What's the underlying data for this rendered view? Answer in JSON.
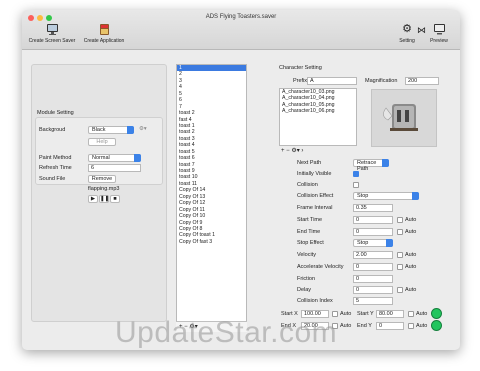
{
  "window": {
    "title": "ADS Flying Toasters.saver"
  },
  "toolbar": {
    "create_screen_saver": "Create Screen Saver",
    "create_application": "Create Application",
    "setting": "Setting",
    "preview": "Preview"
  },
  "module": {
    "heading": "Module Setting",
    "background_label": "Backgroud",
    "background_value": "Black",
    "help": "Help",
    "paint_method_label": "Paint Method",
    "paint_method_value": "Normal",
    "refresh_time_label": "Refresh Time",
    "refresh_time_value": "6",
    "sound_file_label": "Sound File",
    "remove": "Remove",
    "sound_file_name": "flapping.mp3",
    "controls": [
      "▶",
      "❚❚",
      "■"
    ]
  },
  "list": {
    "items": [
      "1",
      "2",
      "3",
      "4",
      "5",
      "6",
      "7",
      "toast 2",
      "fast 4",
      "toast 1",
      "toast 2",
      "toast 3",
      "toast 4",
      "toast 5",
      "toast 6",
      "toast 7",
      "toast 9",
      "toast 10",
      "toast 11",
      "Copy Of 14",
      "Copy Of 13",
      "Copy Of 12",
      "Copy Of 11",
      "Copy Of 10",
      "Copy Of 9",
      "Copy Of 8",
      "Copy Of toast 1",
      "Copy Of fast 3"
    ],
    "toolbar": "+ − ⚙▾"
  },
  "character": {
    "heading": "Character Setting",
    "prefix_label": "Prefix",
    "prefix_value": "A",
    "magnification_label": "Magnification",
    "magnification_value": "200",
    "files": [
      "A_character10_03.png",
      "A_character10_04.png",
      "A_character10_05.png",
      "A_character10_06.png"
    ],
    "file_toolbar": "+ − ⚙▾ ›"
  },
  "props": {
    "next_path_label": "Next Path",
    "next_path_value": "Retrace Path",
    "initially_visible_label": "Initially Visible",
    "collision_label": "Collision",
    "collision_effect_label": "Collision Effect",
    "collision_effect_value": "Stop",
    "frame_interval_label": "Frame Interval",
    "frame_interval_value": "0.35",
    "start_time_label": "Start Time",
    "start_time_value": "0",
    "end_time_label": "End Time",
    "end_time_value": "0",
    "stop_effect_label": "Stop Effect",
    "stop_effect_value": "Stop",
    "velocity_label": "Velocity",
    "velocity_value": "2.00",
    "accel_label": "Accelerate Velocity",
    "accel_value": "0",
    "friction_label": "Friction",
    "friction_value": "0",
    "delay_label": "Delay",
    "delay_value": "0",
    "collision_index_label": "Collision Index",
    "collision_index_value": "5",
    "auto": "Auto",
    "start_x_label": "Start X",
    "start_x_value": "100.00",
    "start_y_label": "Start Y",
    "start_y_value": "80.00",
    "end_x_label": "End X",
    "end_x_value": "20.00",
    "end_y_label": "End Y",
    "end_y_value": "0"
  },
  "watermark": "UpdateStar.com",
  "colors": {
    "accent": "#3b82e8",
    "green": "#22c55e",
    "selection": "#3b7ae0"
  }
}
